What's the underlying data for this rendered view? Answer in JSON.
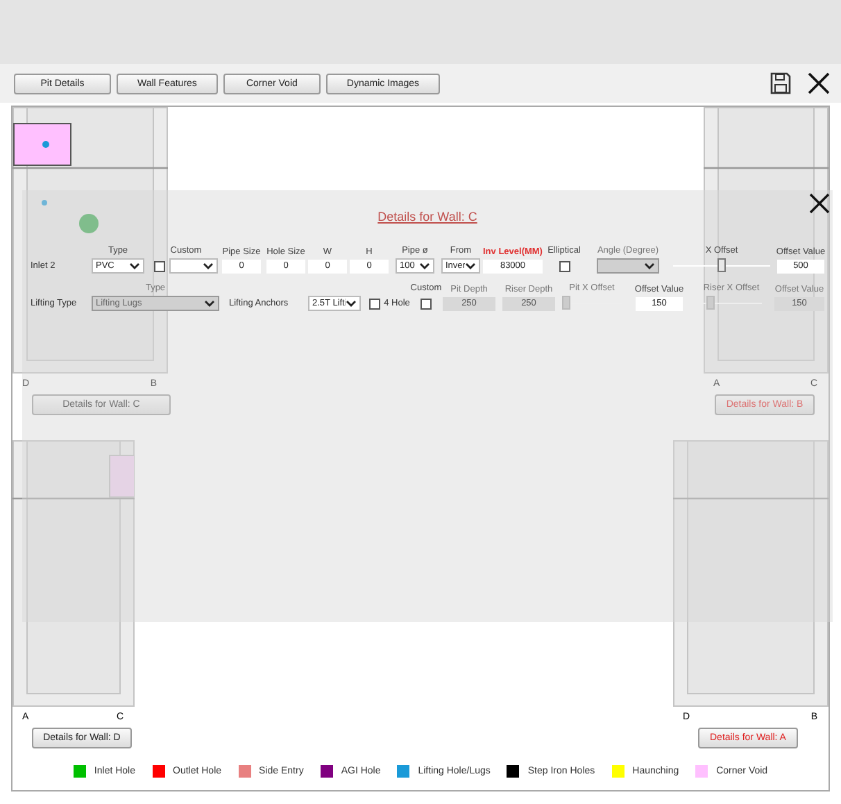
{
  "toolbar": {
    "buttons": [
      "Pit Details",
      "Wall Features",
      "Corner Void",
      "Dynamic Images"
    ]
  },
  "walls": [
    {
      "corner_left": "D",
      "corner_right": "B",
      "button": "Details for Wall: C",
      "flagged": false
    },
    {
      "corner_left": "A",
      "corner_right": "C",
      "button": "Details for Wall: B",
      "flagged": true
    },
    {
      "corner_left": "A",
      "corner_right": "C",
      "button": "Details for Wall: D",
      "flagged": false
    },
    {
      "corner_left": "D",
      "corner_right": "B",
      "button": "Details for Wall: A",
      "flagged": true
    }
  ],
  "dialog": {
    "title": "Details for Wall: C",
    "inlet_row": [
      {
        "kind": "label",
        "text": "Inlet 2"
      },
      {
        "kind": "select",
        "header": "Type",
        "value": "PVC",
        "alert": false,
        "disabled": false
      },
      {
        "kind": "checkbox-select",
        "header": "Custom",
        "checked": false,
        "alert": false,
        "disabled": false
      },
      {
        "kind": "text",
        "header": "Pipe Size",
        "value": "0",
        "alert": false,
        "disabled": false
      },
      {
        "kind": "text",
        "header": "Hole Size",
        "value": "0",
        "alert": false,
        "disabled": false
      },
      {
        "kind": "text",
        "header": "W",
        "value": "0",
        "alert": false,
        "disabled": false
      },
      {
        "kind": "text",
        "header": "H",
        "value": "0",
        "alert": false,
        "disabled": false
      },
      {
        "kind": "select",
        "header": "Pipe ø",
        "value": "100",
        "alert": false,
        "disabled": false
      },
      {
        "kind": "select",
        "header": "From",
        "value": "Inver",
        "alert": false,
        "disabled": false
      },
      {
        "kind": "text",
        "header": "Inv Level(MM)",
        "value": "83000",
        "alert": true,
        "disabled": false
      },
      {
        "kind": "checkbox",
        "header": "Elliptical",
        "checked": false,
        "alert": false,
        "disabled": false
      },
      {
        "kind": "select",
        "header": "Angle (Degree)",
        "alert": false,
        "disabled": true
      },
      {
        "kind": "slider",
        "header": "X Offset",
        "level": 0.5,
        "alert": false,
        "disabled": false
      },
      {
        "kind": "text",
        "header": "Offset Value",
        "value": "500",
        "alert": false,
        "disabled": false
      }
    ],
    "lifting_row": [
      {
        "kind": "label",
        "text": "Lifting Type"
      },
      {
        "kind": "select",
        "header": "Type",
        "value": "Lifting Lugs",
        "disabled": true
      },
      {
        "kind": "label",
        "text": "Lifting Anchors"
      },
      {
        "kind": "select",
        "value": "2.5T Lifti",
        "disabled": false
      },
      {
        "kind": "checkbox",
        "text": "4 Hole",
        "checked": false,
        "disabled": false
      },
      {
        "kind": "checkbox",
        "header": "Custom",
        "checked": false,
        "disabled": false
      },
      {
        "kind": "text",
        "header": "Pit Depth",
        "value": "250",
        "disabled": true
      },
      {
        "kind": "text",
        "header": "Riser Depth",
        "value": "250",
        "disabled": true
      },
      {
        "kind": "slider",
        "header": "Pit X Offset",
        "level": 0.0,
        "disabled": true
      },
      {
        "kind": "text",
        "header": "Offset Value",
        "value": "150",
        "disabled": false
      },
      {
        "kind": "slider",
        "header": "Riser X Offset",
        "level": 0.1,
        "disabled": true
      },
      {
        "kind": "text",
        "header": "Offset Value",
        "value": "150",
        "disabled": true
      }
    ]
  },
  "legend": [
    {
      "label": "Inlet Hole",
      "color": "#00c000"
    },
    {
      "label": "Outlet Hole",
      "color": "#ff0000"
    },
    {
      "label": "Side Entry",
      "color": "#e88080"
    },
    {
      "label": "AGI Hole",
      "color": "#800080"
    },
    {
      "label": "Lifting Hole/Lugs",
      "color": "#1a9ad8"
    },
    {
      "label": "Step Iron Holes",
      "color": "#000000"
    },
    {
      "label": "Haunching",
      "color": "#ffff00"
    },
    {
      "label": "Corner Void",
      "color": "#ffc0ff"
    }
  ]
}
